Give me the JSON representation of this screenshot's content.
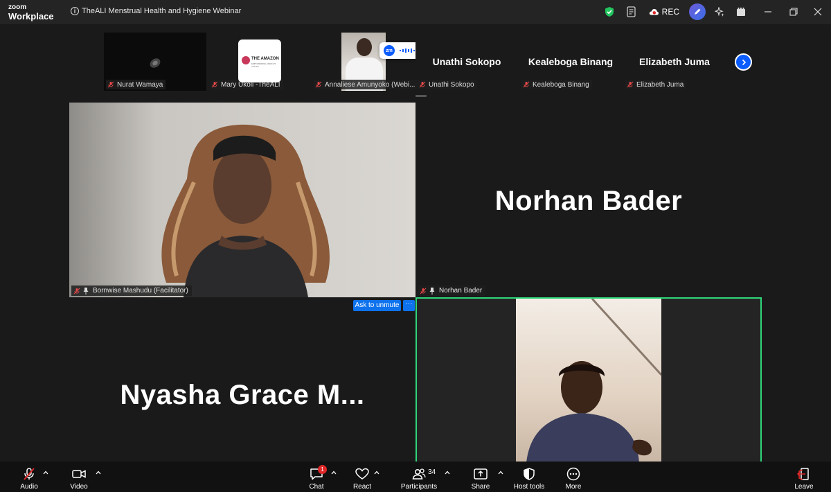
{
  "app": {
    "logo_line1": "zoom",
    "logo_line2": "Workplace",
    "title": "TheALI Menstrual Health and Hygiene Webinar",
    "rec_label": "REC"
  },
  "thumbnails": [
    {
      "label": "Nurat Wamaya"
    },
    {
      "label": "Mary Ukoli -TheALI"
    },
    {
      "label": "Annaliese Amunyoko (Webi..."
    },
    {
      "label": "Unathi Sokopo",
      "name": "Unathi Sokopo"
    },
    {
      "label": "Kealeboga Binang",
      "name": "Kealeboga Binang"
    },
    {
      "label": "Elizabeth Juma",
      "name": "Elizabeth Juma"
    }
  ],
  "amazon_logo": {
    "line1": "THE AMAZON",
    "line2": "EMPOWERING AFRICA'S YOUTH"
  },
  "zm_overlay": {
    "badge": "zm"
  },
  "tiles": {
    "bornwise": {
      "label": "Bornwise Mashudu (Facilitator)"
    },
    "norhan": {
      "label": "Norhan Bader",
      "name": "Norhan Bader"
    },
    "nyasha": {
      "name": "Nyasha  Grace  M..."
    }
  },
  "ask_unmute": {
    "label": "Ask to unmute",
    "more": "···"
  },
  "toolbar": {
    "audio": "Audio",
    "video": "Video",
    "chat": "Chat",
    "chat_badge": "1",
    "react": "React",
    "participants": "Participants",
    "participants_count": "34",
    "share": "Share",
    "host_tools": "Host tools",
    "more": "More",
    "leave": "Leave"
  },
  "colors": {
    "accent_blue": "#0b5cff",
    "active_speaker": "#2fd67a",
    "mic_off_red": "#e04848",
    "shield_green": "#22c55e"
  }
}
